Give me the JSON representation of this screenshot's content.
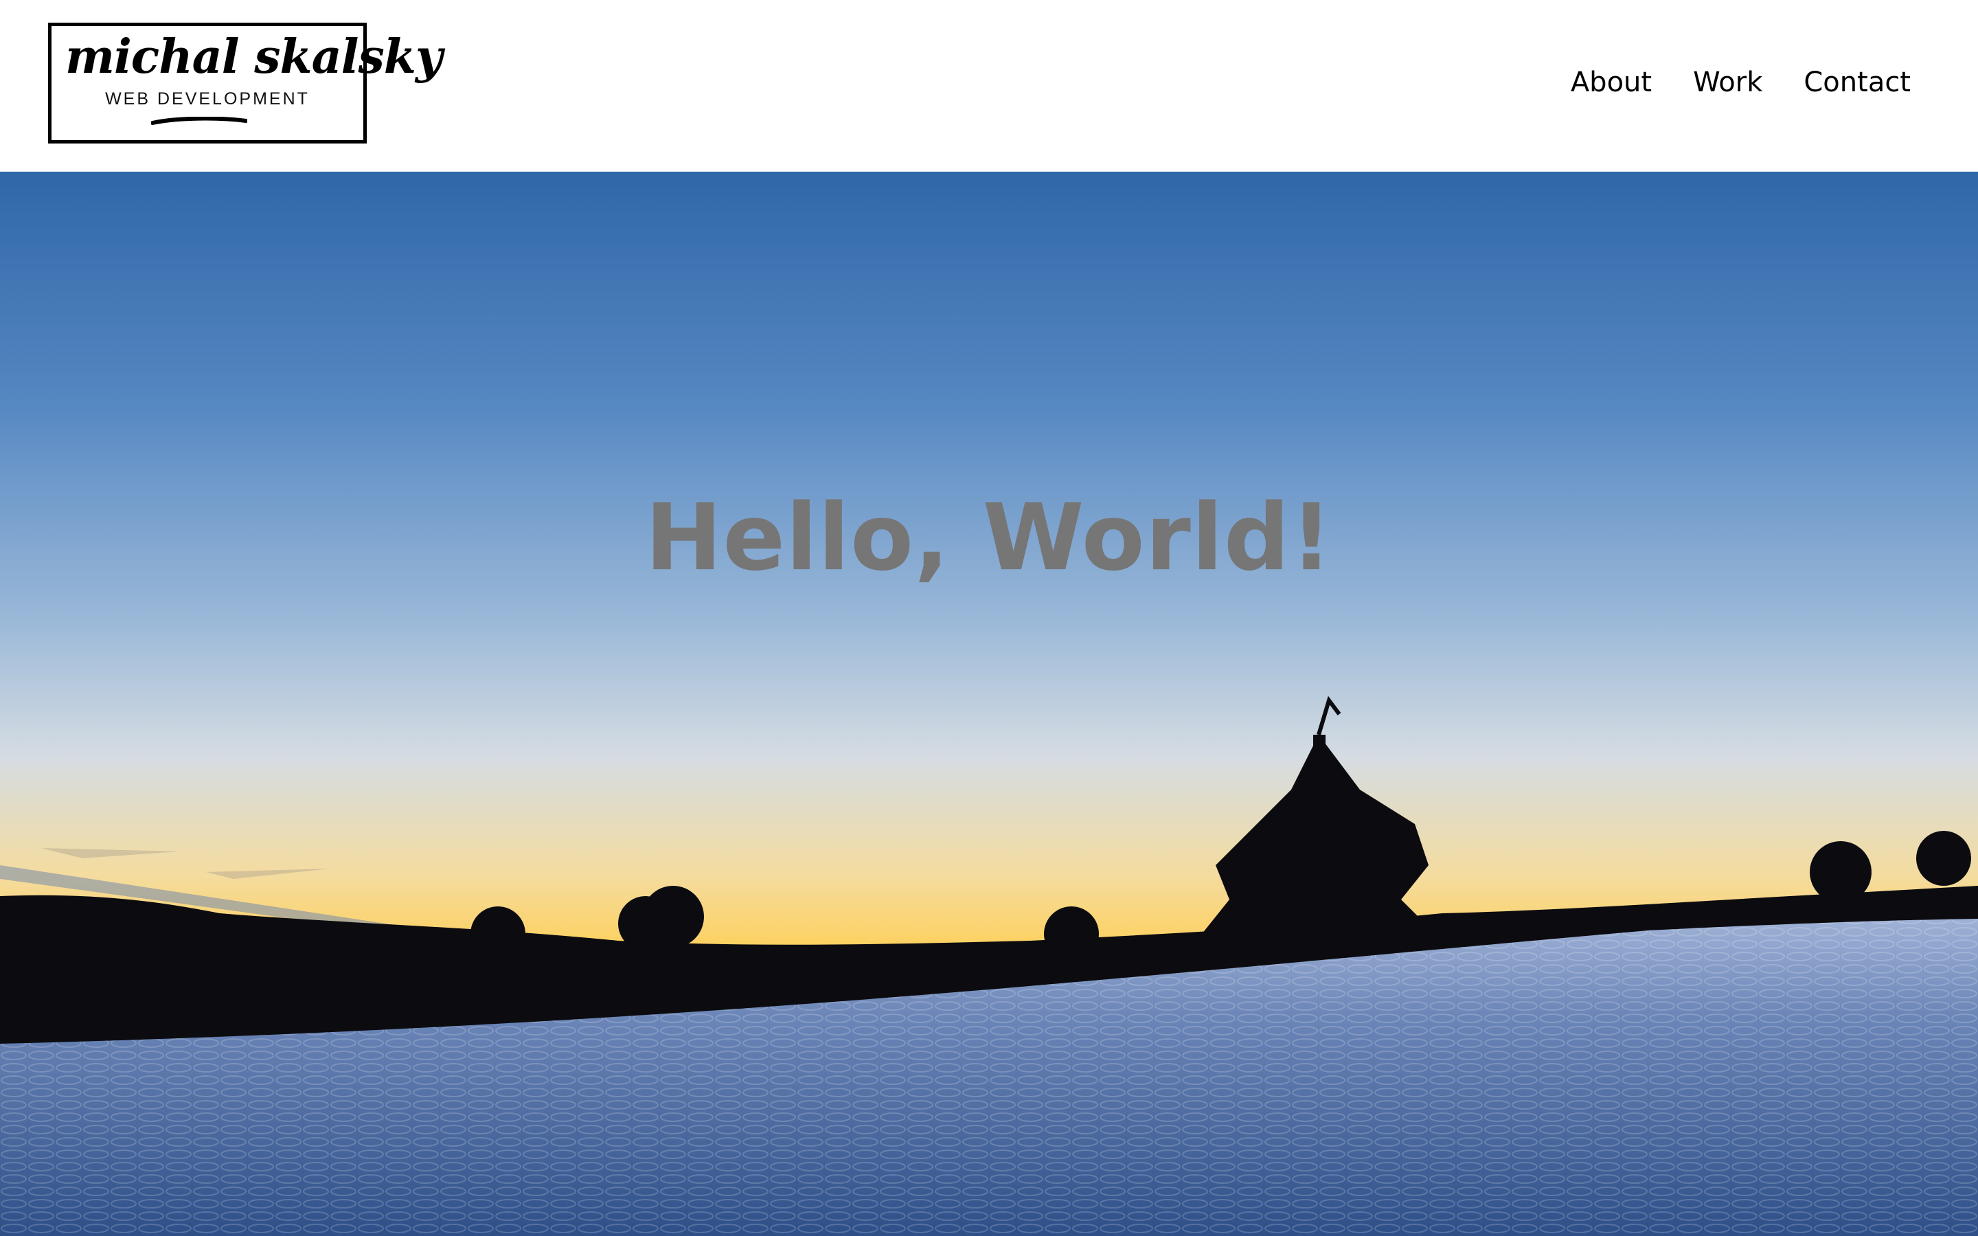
{
  "logo": {
    "script_text": "michal skalsky",
    "subtitle": "WEB DEVELOPMENT"
  },
  "nav": {
    "items": [
      {
        "label": "About"
      },
      {
        "label": "Work"
      },
      {
        "label": "Contact"
      }
    ]
  },
  "hero": {
    "title": "Hello, World!",
    "image_icon": "winter-sunset-landscape"
  },
  "colors": {
    "header_bg": "#ffffff",
    "nav_text": "#000000",
    "hero_title": "#767676",
    "sky_top": "#2f67a8",
    "horizon_glow": "#ffcf55",
    "snow": "#3b5f96"
  }
}
